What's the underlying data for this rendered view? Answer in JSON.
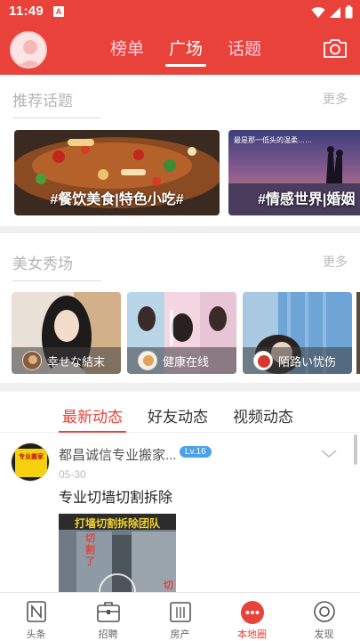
{
  "status_bar": {
    "time": "11:49",
    "indicator": "A"
  },
  "header": {
    "tabs": [
      {
        "label": "榜单",
        "active": false
      },
      {
        "label": "广场",
        "active": true
      },
      {
        "label": "话题",
        "active": false
      }
    ],
    "camera_icon": "camera-icon"
  },
  "recommended_topics": {
    "title": "推荐话题",
    "more": "更多",
    "items": [
      {
        "label": "#餐饮美食|特色小吃#"
      },
      {
        "label": "#情感世界|婚姻",
        "overlay_text": "最是那一低头的温柔……"
      }
    ]
  },
  "beauty_show": {
    "title": "美女秀场",
    "more": "更多",
    "items": [
      {
        "name": "幸せな結末"
      },
      {
        "name": "健康在线"
      },
      {
        "name": "陌路い忧伤"
      }
    ]
  },
  "feed_tabs": [
    {
      "label": "最新动态",
      "active": true
    },
    {
      "label": "好友动态",
      "active": false
    },
    {
      "label": "视频动态",
      "active": false
    }
  ],
  "post": {
    "author": "都昌诚信专业搬家...",
    "level": "Lv.16",
    "date": "05-30",
    "text": "专业切墙切割拆除",
    "avatar_text": "专业搬家",
    "image_caption": "打墙切割拆除团队",
    "image_side_text": "切 割 了",
    "image_side_text2": "切"
  },
  "bottom_nav": [
    {
      "label": "头条",
      "icon": "news-icon",
      "active": false
    },
    {
      "label": "招聘",
      "icon": "briefcase-icon",
      "active": false
    },
    {
      "label": "房产",
      "icon": "building-icon",
      "active": false
    },
    {
      "label": "本地圈",
      "icon": "chat-bubble-icon",
      "active": true
    },
    {
      "label": "发现",
      "icon": "discover-icon",
      "active": false
    }
  ],
  "colors": {
    "brand": "#e8423b",
    "level_badge": "#4aa2e8",
    "separator": "#f0f0f0"
  }
}
